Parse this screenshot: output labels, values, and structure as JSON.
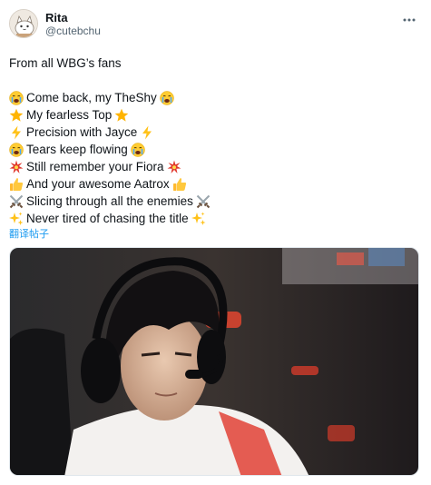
{
  "author": {
    "display_name": "Rita",
    "handle": "@cutebchu"
  },
  "post": {
    "intro": "From all WBG’s fans",
    "lines": [
      {
        "text": "Come back, my TheShy",
        "icon": "crying-face-icon"
      },
      {
        "text": "My fearless Top",
        "icon": "star-icon"
      },
      {
        "text": "Precision with Jayce",
        "icon": "lightning-icon"
      },
      {
        "text": "Tears keep flowing",
        "icon": "crying-face-icon"
      },
      {
        "text": "Still remember your Fiora",
        "icon": "sparkle-burst-icon"
      },
      {
        "text": "And your awesome Aatrox",
        "icon": "thumbs-up-icon"
      },
      {
        "text": "Slicing through all the enemies",
        "icon": "crossed-swords-icon"
      },
      {
        "text": "Never tired of chasing the title",
        "icon": "sparkles-icon"
      }
    ],
    "translate_label": "翻译帖子"
  },
  "media": {
    "alt_subject": "player-with-headset-photo"
  },
  "colors": {
    "link": "#1d9bf0",
    "handle": "#536471",
    "text": "#0f1419"
  }
}
